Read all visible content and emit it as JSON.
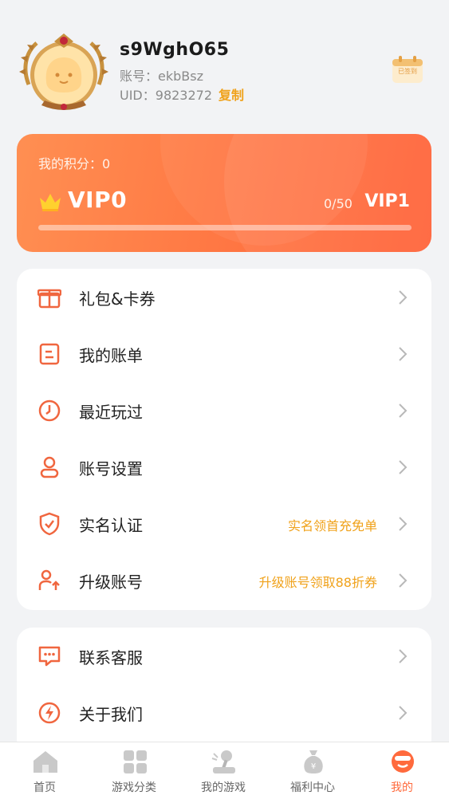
{
  "profile": {
    "username": "s9WghO65",
    "account_label": "账号：",
    "account_value": "ekbBsz",
    "uid_label": "UID：",
    "uid_value": "9823272",
    "copy_label": "复制",
    "checkin_label": "已签到"
  },
  "vip": {
    "points_text": "我的积分：0",
    "level": "VIP0",
    "progress_text": "0/50",
    "progress_fraction": 0,
    "next_level": "VIP1"
  },
  "menu_main": [
    {
      "label": "礼包&卡券",
      "hint": "",
      "icon": "gift-icon"
    },
    {
      "label": "我的账单",
      "hint": "",
      "icon": "bill-icon"
    },
    {
      "label": "最近玩过",
      "hint": "",
      "icon": "clock-icon"
    },
    {
      "label": "账号设置",
      "hint": "",
      "icon": "user-icon"
    },
    {
      "label": "实名认证",
      "hint": "实名领首充免单",
      "icon": "shield-check-icon"
    },
    {
      "label": "升级账号",
      "hint": "升级账号领取88折券",
      "icon": "user-upgrade-icon"
    }
  ],
  "menu_secondary": [
    {
      "label": "联系客服",
      "icon": "chat-icon"
    },
    {
      "label": "关于我们",
      "icon": "lightning-icon"
    }
  ],
  "nav": [
    {
      "label": "首页",
      "icon": "home-icon",
      "active": false
    },
    {
      "label": "游戏分类",
      "icon": "grid-icon",
      "active": false
    },
    {
      "label": "我的游戏",
      "icon": "joystick-icon",
      "active": false
    },
    {
      "label": "福利中心",
      "icon": "money-bag-icon",
      "active": false
    },
    {
      "label": "我的",
      "icon": "profile-face-icon",
      "active": true
    }
  ],
  "colors": {
    "accent": "#ff6a3d",
    "hint": "#f0a21b",
    "icon_orange": "#f0663f"
  }
}
